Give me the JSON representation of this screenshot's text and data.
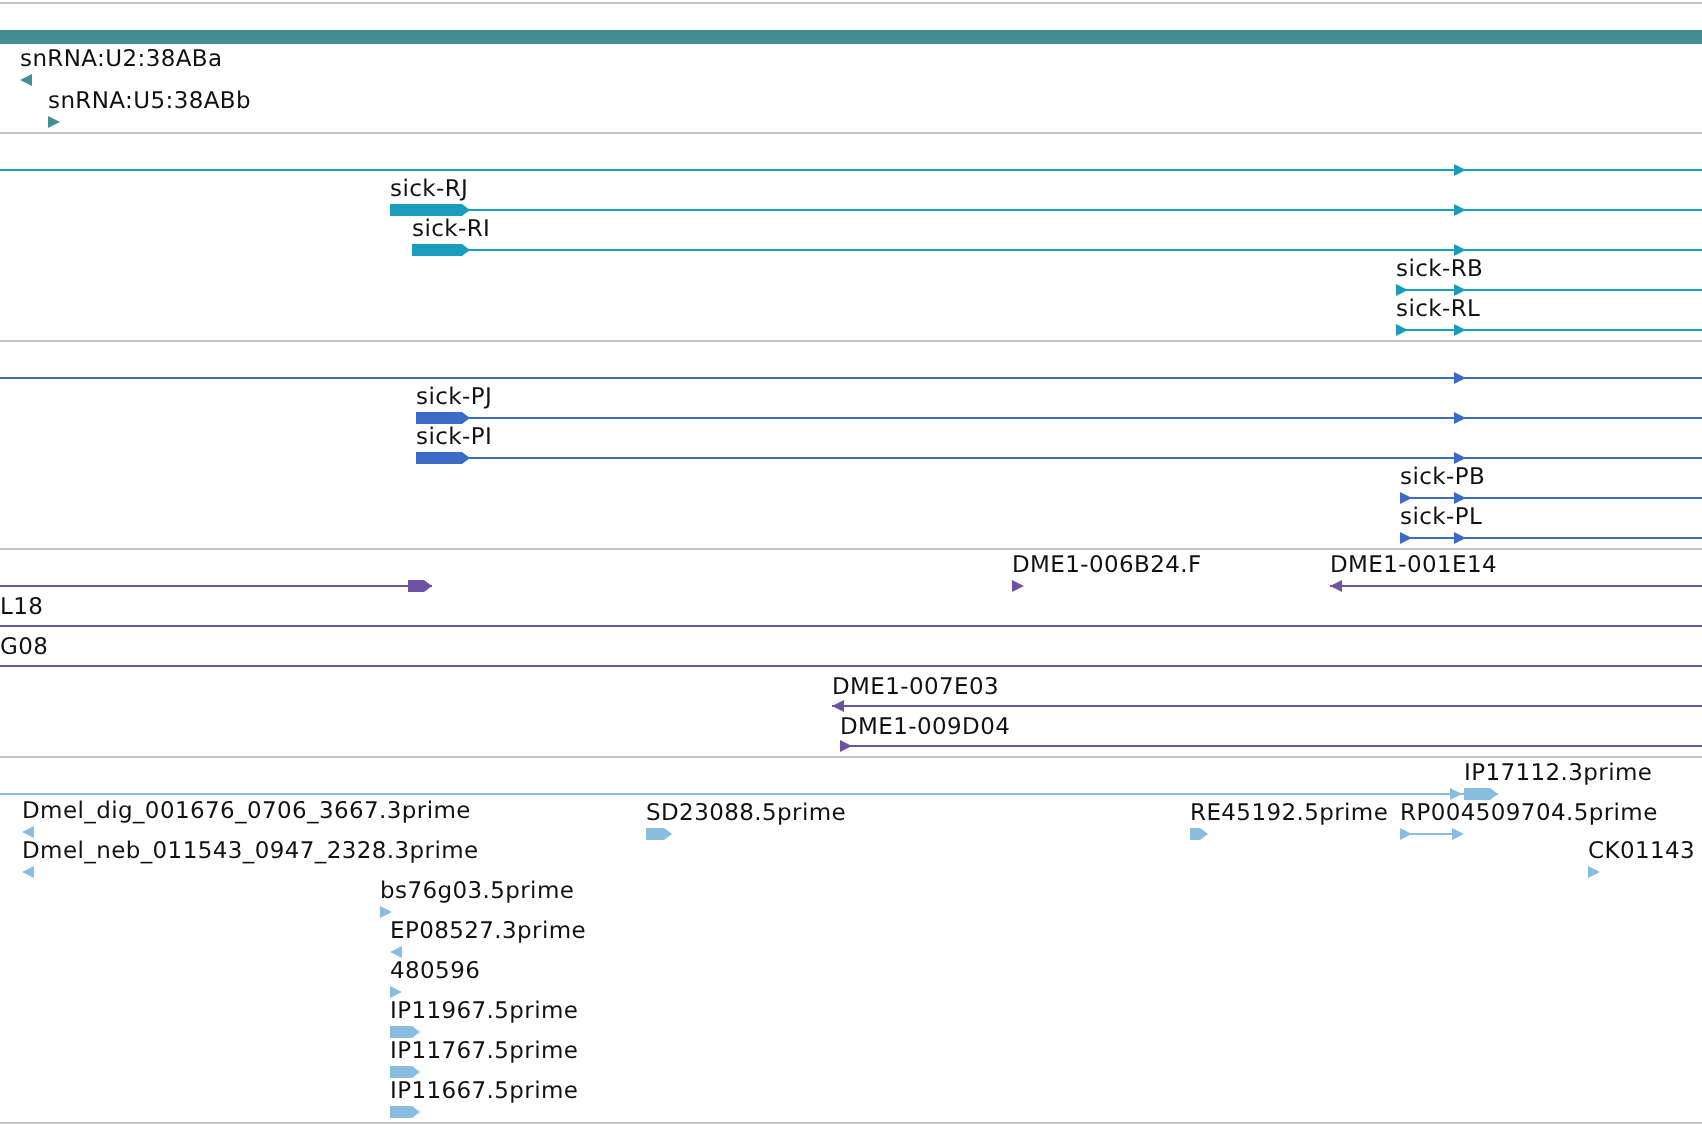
{
  "tracks": [
    {
      "color": "#418f90",
      "features": [
        {
          "kind": "bar"
        },
        {
          "kind": "marker",
          "reverse": true,
          "label": "snRNA:U2:38ABa"
        },
        {
          "kind": "marker",
          "reverse": false,
          "label": "snRNA:U5:38ABb"
        }
      ]
    },
    {
      "color": "#1a9cbd",
      "features": [
        {
          "kind": "transcript",
          "reverse": false
        },
        {
          "kind": "transcript",
          "reverse": false,
          "label": "sick-RJ"
        },
        {
          "kind": "transcript",
          "reverse": false,
          "label": "sick-RI"
        },
        {
          "kind": "transcript",
          "reverse": false,
          "label": "sick-RB"
        },
        {
          "kind": "transcript",
          "reverse": false,
          "label": "sick-RL"
        }
      ]
    },
    {
      "color": "#3a6bc8",
      "features": [
        {
          "kind": "transcript",
          "reverse": false
        },
        {
          "kind": "transcript",
          "reverse": false,
          "label": "sick-PJ"
        },
        {
          "kind": "transcript",
          "reverse": false,
          "label": "sick-PI"
        },
        {
          "kind": "transcript",
          "reverse": false,
          "label": "sick-PB"
        },
        {
          "kind": "transcript",
          "reverse": false,
          "label": "sick-PL"
        }
      ]
    },
    {
      "color": "#6e52a3",
      "features": [
        {
          "kind": "transcript",
          "reverse": false
        },
        {
          "kind": "marker",
          "reverse": false,
          "label": "DME1-006B24.F"
        },
        {
          "kind": "transcript",
          "reverse": true,
          "label": "DME1-001E14"
        },
        {
          "kind": "transcript",
          "label": "L18"
        },
        {
          "kind": "transcript",
          "label": "G08"
        },
        {
          "kind": "transcript",
          "reverse": true,
          "label": "DME1-007E03"
        },
        {
          "kind": "transcript",
          "reverse": false,
          "label": "DME1-009D04"
        }
      ]
    },
    {
      "color": "#88bde0",
      "features": [
        {
          "kind": "transcript",
          "reverse": false,
          "label": "IP17112.3prime"
        },
        {
          "kind": "marker",
          "reverse": true,
          "label": "Dmel_dig_001676_0706_3667.3prime"
        },
        {
          "kind": "marker",
          "reverse": false,
          "label": "SD23088.5prime"
        },
        {
          "kind": "marker",
          "reverse": false,
          "label": "RE45192.5prime"
        },
        {
          "kind": "transcript",
          "reverse": false,
          "label": "RP004509704.5prime"
        },
        {
          "kind": "marker",
          "reverse": true,
          "label": "Dmel_neb_011543_0947_2328.3prime"
        },
        {
          "kind": "marker",
          "reverse": false,
          "label": "CK01143"
        },
        {
          "kind": "marker",
          "reverse": false,
          "label": "bs76g03.5prime"
        },
        {
          "kind": "marker",
          "reverse": true,
          "label": "EP08527.3prime"
        },
        {
          "kind": "marker",
          "reverse": false,
          "label": "480596"
        },
        {
          "kind": "marker",
          "reverse": false,
          "label": "IP11967.5prime"
        },
        {
          "kind": "marker",
          "reverse": false,
          "label": "IP11767.5prime"
        },
        {
          "kind": "marker",
          "reverse": false,
          "label": "IP11667.5prime"
        }
      ]
    }
  ]
}
